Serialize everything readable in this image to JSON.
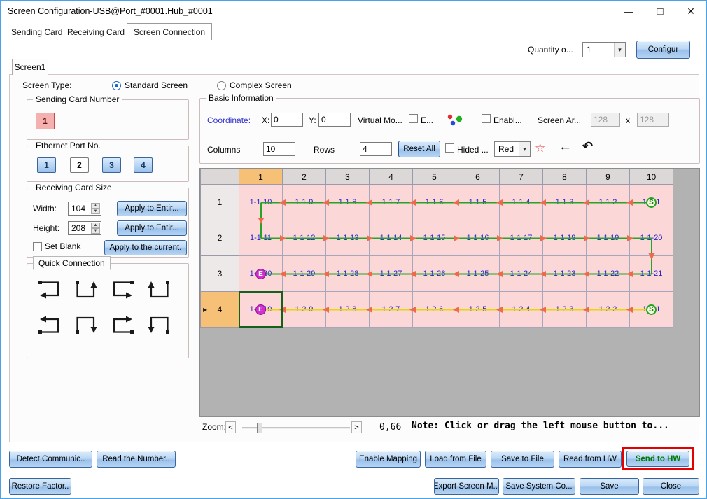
{
  "window": {
    "title": "Screen Configuration-USB@Port_#0001.Hub_#0001"
  },
  "icons": {
    "minimize": "—",
    "maximize": "□",
    "close": "×",
    "chevron_down": "▾",
    "spin_up": "▲",
    "spin_down": "▼",
    "row_indicator": "▶",
    "star": "☆",
    "back_arrow": "←",
    "undo_arrow": "↶"
  },
  "tabs": {
    "items": [
      "Sending Card",
      "Receiving Card",
      "Screen Connection"
    ],
    "active": "Screen Connection"
  },
  "header_controls": {
    "quantity_label": "Quantity o...",
    "quantity_value": "1",
    "configure": "Configur"
  },
  "screen_tabs": {
    "screen1": "Screen1"
  },
  "screen_type": {
    "label": "Screen Type:",
    "standard_label": "Standard Screen",
    "complex_label": "Complex Screen"
  },
  "sending_card": {
    "title": "Sending Card Number",
    "card1": "1"
  },
  "ethernet": {
    "title": "Ethernet Port No.",
    "ports": [
      "1",
      "2",
      "3",
      "4"
    ],
    "selected_port": "2"
  },
  "card_size": {
    "title": "Receiving Card Size",
    "width_label": "Width:",
    "width_value": "104",
    "height_label": "Height:",
    "height_value": "208",
    "apply_width": "Apply to Entir...",
    "apply_height": "Apply to Entir...",
    "set_blank_label": "Set Blank",
    "apply_current": "Apply to the current."
  },
  "quick_connection": {
    "title": "Quick Connection"
  },
  "basic_info": {
    "title": "Basic Information",
    "coordinate_label": "Coordinate:",
    "x_label": "X:",
    "x_value": "0",
    "y_label": "Y:",
    "y_value": "0",
    "virtual_label": "Virtual Mo...",
    "e_label": "E...",
    "enable_label": "Enabl...",
    "screen_area_label": "Screen Ar...",
    "area_width": "128",
    "area_times": "x",
    "area_height": "128",
    "columns_label": "Columns",
    "columns_value": "10",
    "rows_label": "Rows",
    "rows_value": "4",
    "reset_all": "Reset All",
    "hided_label": "Hided ...",
    "color_select": "Red"
  },
  "grid": {
    "column_headers": [
      "1",
      "2",
      "3",
      "4",
      "5",
      "6",
      "7",
      "8",
      "9",
      "10"
    ],
    "row_headers": [
      "1",
      "2",
      "3",
      "4"
    ],
    "highlight_col": 1,
    "highlight_row": 4,
    "selected": {
      "row": 4,
      "col": 1
    },
    "cells": [
      [
        "1-1-10",
        "1-1-9",
        "1-1-8",
        "1-1-7",
        "1-1-6",
        "1-1-5",
        "1-1-4",
        "1-1-3",
        "1-1-2",
        "1-1-1"
      ],
      [
        "1-1-11",
        "1-1-12",
        "1-1-13",
        "1-1-14",
        "1-1-15",
        "1-1-16",
        "1-1-17",
        "1-1-18",
        "1-1-19",
        "1-1-20"
      ],
      [
        "1-1-30",
        "1-1-29",
        "1-1-28",
        "1-1-27",
        "1-1-26",
        "1-1-25",
        "1-1-24",
        "1-1-23",
        "1-1-22",
        "1-1-21"
      ],
      [
        "1-2-10",
        "1-2-9",
        "1-2-8",
        "1-2-7",
        "1-2-6",
        "1-2-5",
        "1-2-4",
        "1-2-3",
        "1-2-2",
        "1-2-1"
      ]
    ],
    "markers": [
      {
        "row": 1,
        "col": 10,
        "label": "S"
      },
      {
        "row": 3,
        "col": 1,
        "label": "E"
      },
      {
        "row": 4,
        "col": 1,
        "label": "E"
      },
      {
        "row": 4,
        "col": 10,
        "label": "S"
      }
    ],
    "runs": [
      {
        "type": "h",
        "row": 1,
        "from": 10,
        "to": 1,
        "color": "#27a427"
      },
      {
        "type": "v",
        "col": 1,
        "from": 1,
        "to": 2,
        "color": "#27a427"
      },
      {
        "type": "h",
        "row": 2,
        "from": 1,
        "to": 10,
        "color": "#27a427"
      },
      {
        "type": "v",
        "col": 10,
        "from": 2,
        "to": 3,
        "color": "#27a427"
      },
      {
        "type": "h",
        "row": 3,
        "from": 10,
        "to": 1,
        "color": "#27a427"
      },
      {
        "type": "h",
        "row": 4,
        "from": 10,
        "to": 1,
        "color": "#e8d60a"
      }
    ],
    "arrow_color": "#ef6a4a",
    "selection_color": "#14611c"
  },
  "zoom": {
    "label": "Zoom:",
    "decrease": "<",
    "increase": ">",
    "value": "0,66",
    "note": "Note: Click or drag the left mouse button to..."
  },
  "actions": {
    "detect": "Detect Communic..",
    "read_number": "Read the Number..",
    "enable_mapping": "Enable Mapping",
    "load_file": "Load from File",
    "save_file": "Save to File",
    "read_hw": "Read from HW",
    "send_hw": "Send to HW",
    "restore": "Restore Factor..",
    "export_screen": "Export Screen M...",
    "save_system": "Save System Co...",
    "save": "Save",
    "close": "Close"
  }
}
